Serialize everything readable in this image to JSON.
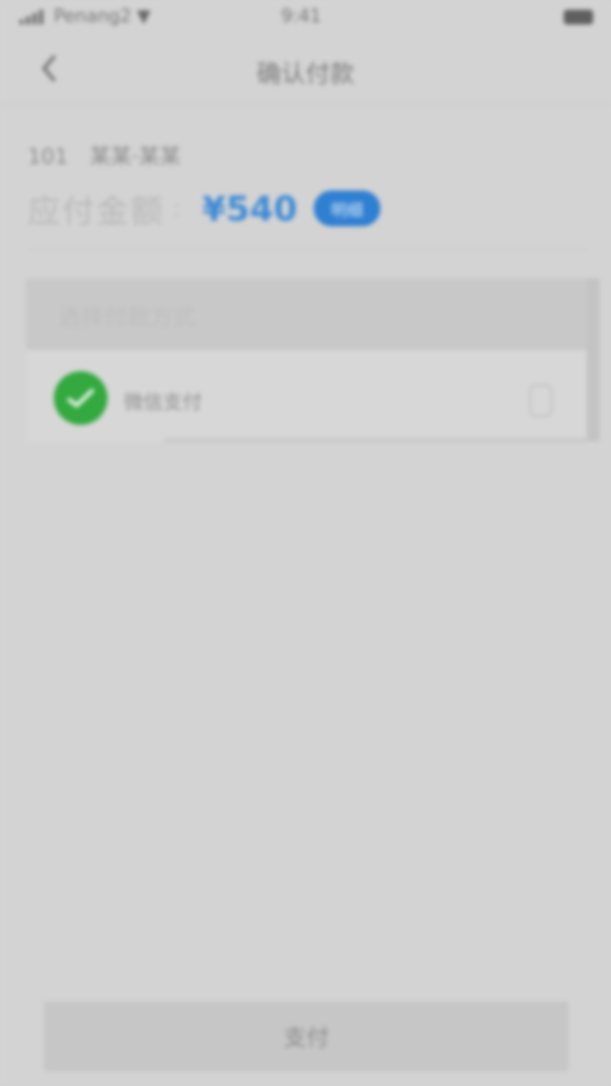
{
  "status_bar": {
    "carrier": "Penang2",
    "time": "9:41"
  },
  "nav": {
    "title": "确认付款"
  },
  "order": {
    "room": "101",
    "info": "某某·某某"
  },
  "amount": {
    "label": "应付金额",
    "separator": ":",
    "value": "¥540",
    "badge": "明细",
    "accent_color": "#3e8ad6"
  },
  "payment": {
    "header": "选择付款方式",
    "options": [
      {
        "label": "微信支付",
        "icon": "wechat-pay-icon",
        "color": "#33a93f"
      }
    ]
  },
  "pay_button": {
    "label": "支付"
  }
}
